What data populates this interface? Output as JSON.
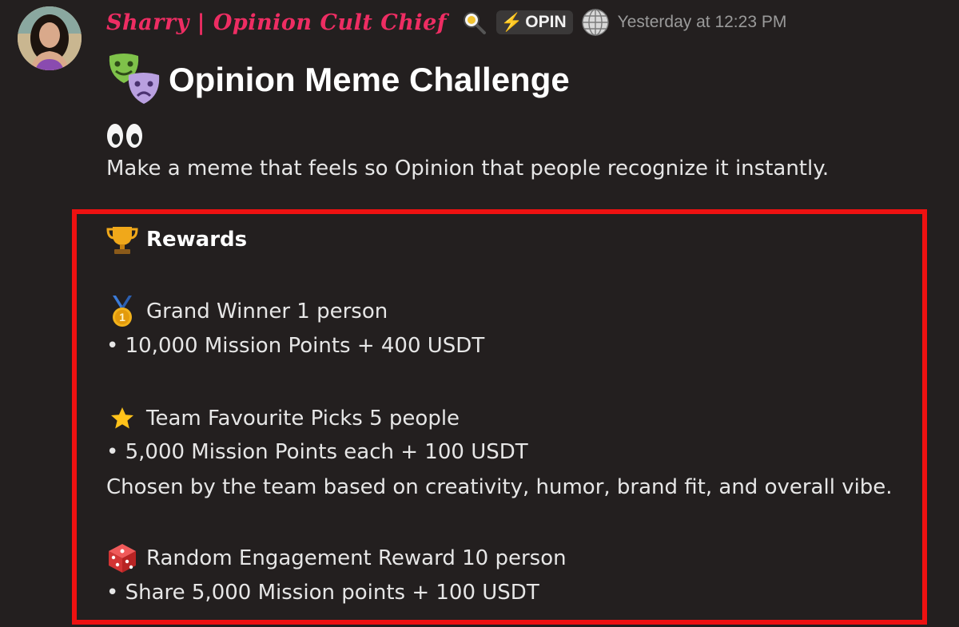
{
  "author": {
    "name": "Sharry | Opinion Cult Chief",
    "tag": "OPIN",
    "timestamp": "Yesterday at 12:23 PM"
  },
  "message": {
    "title": "Opinion Meme Challenge",
    "intro": "Make a meme that feels so Opinion that people recognize it instantly.",
    "rewards_heading": "Rewards",
    "rewards": [
      {
        "icon": "first-place-medal-icon",
        "heading": "Grand Winner 1 person",
        "lines": [
          "• 10,000 Mission Points + 400 USDT"
        ]
      },
      {
        "icon": "star-icon",
        "heading": "Team Favourite Picks 5 people",
        "lines": [
          "• 5,000 Mission Points each + 100 USDT",
          "Chosen by the team based on creativity, humor, brand fit, and overall vibe."
        ]
      },
      {
        "icon": "dice-icon",
        "heading": "Random Engagement Reward 10 person",
        "lines": [
          "• Share 5,000 Mission points + 100 USDT"
        ]
      }
    ]
  },
  "colors": {
    "background": "#231f1f",
    "username": "#ee2d63",
    "highlight_border": "#ee1111",
    "timestamp": "#9a9a9a"
  }
}
